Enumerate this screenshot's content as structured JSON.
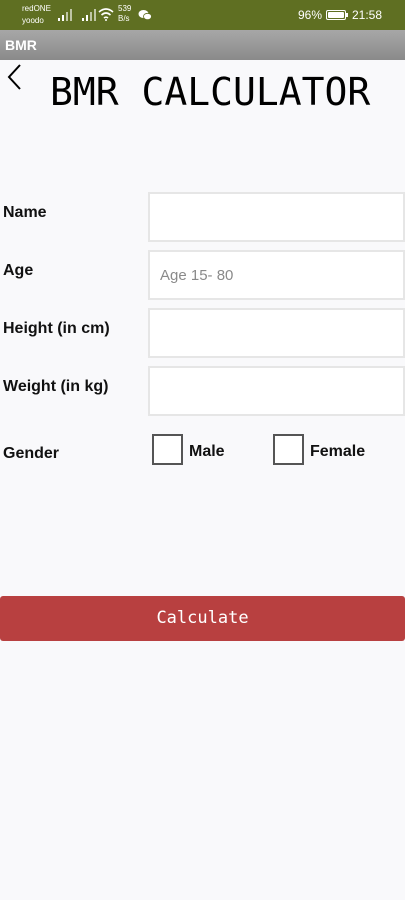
{
  "status_bar": {
    "carrier_line1": "redONE",
    "carrier_line2": "yoodo",
    "net_speed_value": "539",
    "net_speed_unit": "B/s",
    "battery": "96%",
    "time": "21:58"
  },
  "app_bar": {
    "title": "BMR"
  },
  "page": {
    "heading": "BMR CALCULATOR"
  },
  "form": {
    "name": {
      "label": "Name",
      "value": "",
      "placeholder": ""
    },
    "age": {
      "label": "Age",
      "value": "",
      "placeholder": "Age 15- 80"
    },
    "height": {
      "label": "Height (in cm)",
      "value": "",
      "placeholder": ""
    },
    "weight": {
      "label": "Weight (in kg)",
      "value": "",
      "placeholder": ""
    },
    "gender": {
      "label": "Gender",
      "options": [
        "Male",
        "Female"
      ]
    }
  },
  "actions": {
    "calculate": "Calculate"
  },
  "icons": {
    "back": "chevron-left-icon",
    "signal": "signal-icon",
    "wifi": "wifi-icon",
    "wechat": "wechat-icon",
    "battery": "battery-icon"
  },
  "colors": {
    "status_bar": "#5f6f22",
    "calculate_button": "#b84040",
    "app_bar": "#999999"
  }
}
